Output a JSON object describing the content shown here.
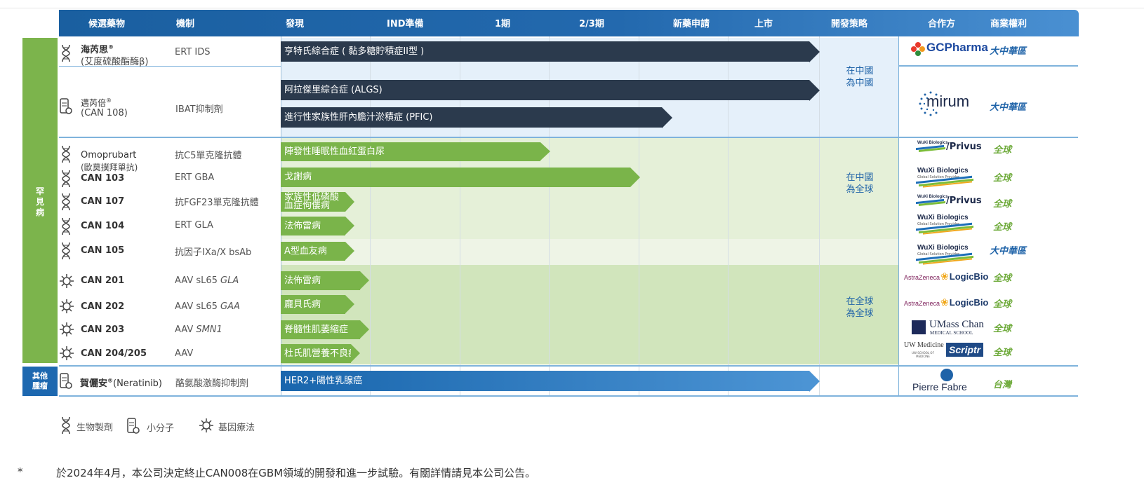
{
  "header": {
    "candidate": "候選藥物",
    "mechanism": "機制",
    "discovery": "發現",
    "ind": "IND準備",
    "phase1": "1期",
    "phase23": "2/3期",
    "nda": "新藥申請",
    "launch": "上市",
    "strategy": "開發策略",
    "partner": "合作方",
    "rights": "商業權利"
  },
  "categories": {
    "rare": "罕\n見\n病",
    "oncology": "其他\n腫瘤"
  },
  "rows": {
    "hunterase": {
      "name": "海芮思",
      "sup": "®",
      "sub": "(艾度硫酸酯酶β)",
      "mech": "ERT IDS",
      "bar": "亨特氏綜合症 ( 黏多糖貯積症II型 )",
      "partner_brand": "GCPharma",
      "right": "大中華區"
    },
    "livmarli": {
      "name": "邁芮倍",
      "sup": "®",
      "sub": "(CAN 108)",
      "mech": "IBAT抑制劑",
      "bar1": "阿拉傑里綜合症 (ALGS)",
      "bar2": "進行性家族性肝內膽汁淤積症 (PFIC)",
      "partner_brand": "mirum",
      "right": "大中華區"
    },
    "omoprubart": {
      "name": "Omoprubart",
      "sub": "(歐莫撲拜單抗)",
      "mech": "抗C5單克隆抗體",
      "bar": "陣發性睡眠性血紅蛋白尿",
      "partner_brand": "WuXi Biologics/Privus",
      "right": "全球"
    },
    "can103": {
      "name": "CAN 103",
      "mech": "ERT GBA",
      "bar": "戈謝病",
      "partner_brand": "WuXi Biologics",
      "right": "全球"
    },
    "can107": {
      "name": "CAN 107",
      "mech": "抗FGF23單克隆抗體",
      "bar": "家族性低磷酸\n血症佝僂病",
      "partner_brand": "WuXi Biologics/Privus",
      "right": "全球"
    },
    "can104": {
      "name": "CAN 104",
      "mech": "ERT GLA",
      "bar": "法佈雷病",
      "partner_brand": "WuXi Biologics",
      "right": "全球"
    },
    "can105": {
      "name": "CAN 105",
      "mech": "抗因子IXa/X bsAb",
      "bar": "A型血友病",
      "partner_brand": "WuXi Biologics",
      "right": "大中華區"
    },
    "can201": {
      "name": "CAN 201",
      "mech_pre": "AAV sL65 ",
      "mech_it": "GLA",
      "bar": "法佈雷病",
      "partner_brand": "AstraZeneca LogicBio",
      "right": "全球"
    },
    "can202": {
      "name": "CAN 202",
      "mech_pre": "AAV sL65 ",
      "mech_it": "GAA",
      "bar": "龐貝氏病",
      "partner_brand": "AstraZeneca LogicBio",
      "right": "全球"
    },
    "can203": {
      "name": "CAN 203",
      "mech_pre": "AAV ",
      "mech_it": "SMN1",
      "bar": "脊髓性肌萎縮症",
      "partner_brand": "UMass Chan MEDICAL SCHOOL",
      "right": "全球"
    },
    "can204": {
      "name": "CAN 204/205",
      "mech": "AAV",
      "bar": "杜氏肌營養不良症",
      "partner_brand": "UW Medicine Scriptr",
      "right": "全球"
    },
    "nerlynx": {
      "name": "賀儷安",
      "sup": "®",
      "name_suffix": "(Neratinib)",
      "mech": "酪氨酸激酶抑制劑",
      "bar": "HER2+陽性乳腺癌",
      "partner_brand": "Pierre Fabre",
      "right": "台灣"
    }
  },
  "strategy": {
    "s1": "在中國\n為中國",
    "s2": "在中國\n為全球",
    "s3": "在全球\n為全球"
  },
  "partners": {
    "gc": "GCPharma",
    "mirum": "mirum",
    "wuxi": "WuXi Biologics",
    "wuxi_sub": "Global Solution Provider",
    "privus": "/Privus",
    "az": "AstraZeneca",
    "logicbio": "LogicBio",
    "umass": "UMass Chan",
    "umass_sub": "MEDICAL SCHOOL",
    "uw": "UW Medicine",
    "uw_sub": "UW SCHOOL OF MEDICINE",
    "scriptr": "Scriptr",
    "pierre": "Pierre Fabre"
  },
  "legend": {
    "bio": "生物製劑",
    "small": "小分子",
    "gene": "基因療法"
  },
  "footnote": {
    "mark": "*",
    "text": "於2024年4月，本公司決定終止CAN008在GBM領域的開發和進一步試驗。有關詳情請見本公司公告。"
  },
  "colors": {
    "header_blue": "#1a5fa0",
    "dark_bar": "#2b3a4d",
    "green_bar": "#7ab44a",
    "blue_bar": "#1966ad",
    "rare_cat": "#7cb44c",
    "onc_cat": "#1d68b0",
    "right_green": "#6fab3c",
    "right_blue": "#1f63a8"
  }
}
